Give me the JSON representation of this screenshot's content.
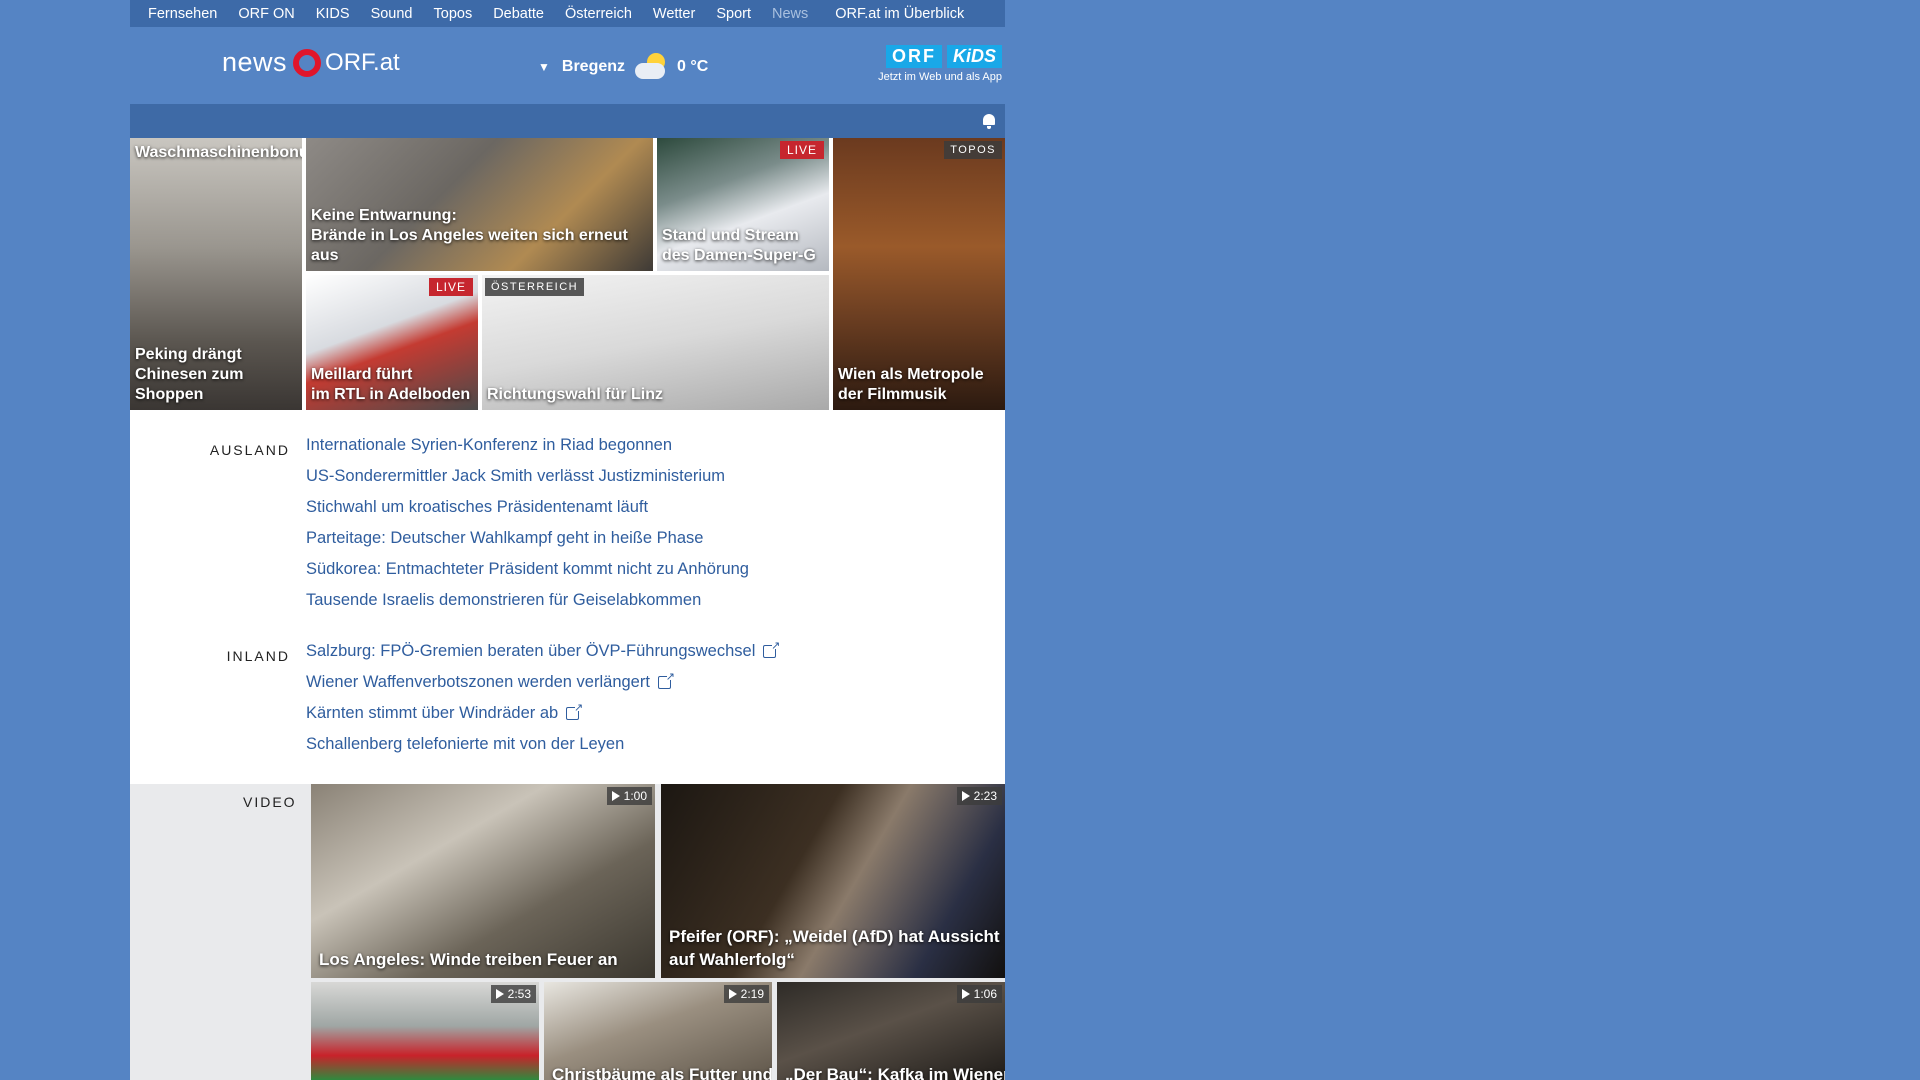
{
  "topnav": {
    "items": [
      "Fernsehen",
      "ORF ON",
      "KIDS",
      "Sound",
      "Topos",
      "Debatte",
      "Österreich",
      "Wetter",
      "Sport",
      "News"
    ],
    "active": "News",
    "overview": "ORF.at im Überblick"
  },
  "header": {
    "logo_news": "news",
    "logo_orf": "ORF.at",
    "weather_city": "Bregenz",
    "weather_temp": "0 °C",
    "weather_icon": "partly-cloudy-icon",
    "kids_badge_orf": "ORF",
    "kids_badge_kids": "KiDS",
    "kids_sub": "Jetzt im Web und als App"
  },
  "tiles": [
    {
      "caption_top": "Waschmaschinenbonus:",
      "caption": "Peking drängt\nChinesen zum Shoppen"
    },
    {
      "caption": "Keine Entwarnung:\nBrände in Los Angeles weiten sich erneut aus"
    },
    {
      "badge": "LIVE",
      "caption": "Stand und Stream\ndes Damen-Super-G"
    },
    {
      "badge": "TOPOS",
      "caption": "Wien als Metropole\nder Filmmusik"
    },
    {
      "badge": "LIVE",
      "caption": "Meillard führt\nim RTL in Adelboden"
    },
    {
      "badge": "ÖSTERREICH",
      "caption": "Richtungswahl für Linz"
    }
  ],
  "sections": {
    "ausland": {
      "label": "AUSLAND",
      "links": [
        "Internationale Syrien-Konferenz in Riad begonnen",
        "US-Sonderermittler Jack Smith verlässt Justizministerium",
        "Stichwahl um kroatisches Präsidentenamt läuft",
        "Parteitage: Deutscher Wahlkampf geht in heiße Phase",
        "Südkorea: Entmachteter Präsident kommt nicht zu Anhörung",
        "Tausende Israelis demonstrieren für Geiselabkommen"
      ]
    },
    "inland": {
      "label": "INLAND",
      "links": [
        "Salzburg: FPÖ-Gremien beraten über ÖVP-Führungswechsel",
        "Wiener Waffenverbotszonen werden verlängert",
        "Kärnten stimmt über Windräder ab",
        "Schallenberg telefonierte mit von der Leyen"
      ]
    }
  },
  "video": {
    "label": "VIDEO",
    "items": [
      {
        "duration": "1:00",
        "caption": "Los Angeles: Winde treiben Feuer an"
      },
      {
        "duration": "2:23",
        "caption": "Pfeifer (ORF): „Weidel (AfD) hat Aussicht\nauf Wahlerfolg“"
      },
      {
        "duration": "2:53",
        "caption": ""
      },
      {
        "duration": "2:19",
        "caption": "Christbäume als Futter und"
      },
      {
        "duration": "1:06",
        "caption": "„Der Bau“: Kafka im Wiener"
      }
    ]
  }
}
